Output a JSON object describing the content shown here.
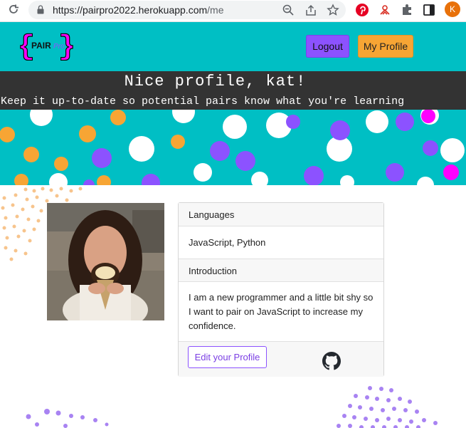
{
  "browser": {
    "url_host": "https://pairpro2022.herokuapp.com",
    "url_path": "/me",
    "profile_initial": "K",
    "icons": [
      "reload-icon",
      "lock-icon",
      "zoom-icon",
      "share-icon",
      "star-icon",
      "pinterest-icon",
      "extension-icon",
      "puzzle-icon",
      "sidepanel-icon"
    ]
  },
  "navbar": {
    "logo_text": "PAIR",
    "logo_suffix": "Pro",
    "logout_label": "Logout",
    "profile_label": "My Profile",
    "colors": {
      "bar": "#00bfc4",
      "logout": "#8c52ff",
      "profile": "#f7a534"
    }
  },
  "hero": {
    "headline": "Nice profile, kat!",
    "subline": "Keep it up-to-date so potential pairs know what you're learning"
  },
  "profile": {
    "languages_heading": "Languages",
    "languages_value": "JavaScript, Python",
    "intro_heading": "Introduction",
    "intro_line1": "I am a new programmer and a little bit shy so",
    "intro_line2": "I want to pair on JavaScript to increase my",
    "intro_line3": "confidence.",
    "edit_label": "Edit your Profile"
  }
}
